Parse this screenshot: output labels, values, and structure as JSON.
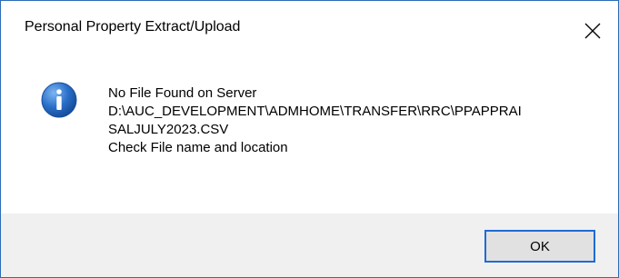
{
  "window": {
    "title": "Personal Property Extract/Upload"
  },
  "icons": {
    "info": "info-icon",
    "close": "close-icon"
  },
  "message": {
    "line1": "No File Found on Server",
    "line2": "D:\\AUC_DEVELOPMENT\\ADMHOME\\TRANSFER\\RRC\\PPAPPRAI",
    "line3": "SALJULY2023.CSV",
    "line4": "Check File name and location"
  },
  "buttons": {
    "ok_label": "OK"
  },
  "colors": {
    "window_border": "#2b6cb8",
    "footer_background": "#f0f0f0",
    "button_focus_border": "#1e6bd6",
    "info_icon_blue": "#2a6fc9"
  }
}
